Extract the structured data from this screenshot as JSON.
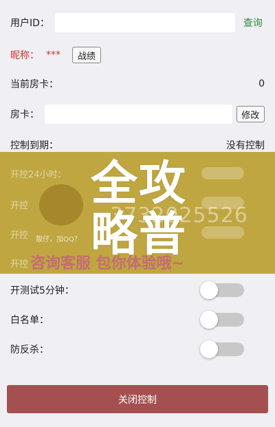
{
  "form": {
    "user_id_label": "用户ID：",
    "query_label": "查询",
    "nickname_label": "昵称：",
    "nickname_value": "***",
    "record_label": "战绩",
    "current_card_label": "当前房卡：",
    "current_card_value": "0",
    "card_label": "房卡：",
    "modify_label": "修改",
    "expire_label": "控制到期：",
    "expire_value": "没有控制"
  },
  "overlay": {
    "row1": "开控24小时：",
    "row2": "开控",
    "row3": "开控",
    "row4": "开控",
    "big_text_line1": "全攻",
    "big_text_line2": "略普",
    "phone": "3732025526",
    "face_caption": "靓仔，加QQ？",
    "promo": "咨询客服  包你体验哦~"
  },
  "toggles": {
    "test5_label": "开测试5分钟：",
    "whitelist_label": "白名单：",
    "anti_kill_label": "防反杀：",
    "test5_on": false,
    "whitelist_on": false,
    "anti_kill_on": false
  },
  "close_button": "关闭控制",
  "colors": {
    "query": "#2e8b3a",
    "nickname": "#d0342c",
    "close_bg": "#a45050",
    "overlay": "#b4961a"
  }
}
